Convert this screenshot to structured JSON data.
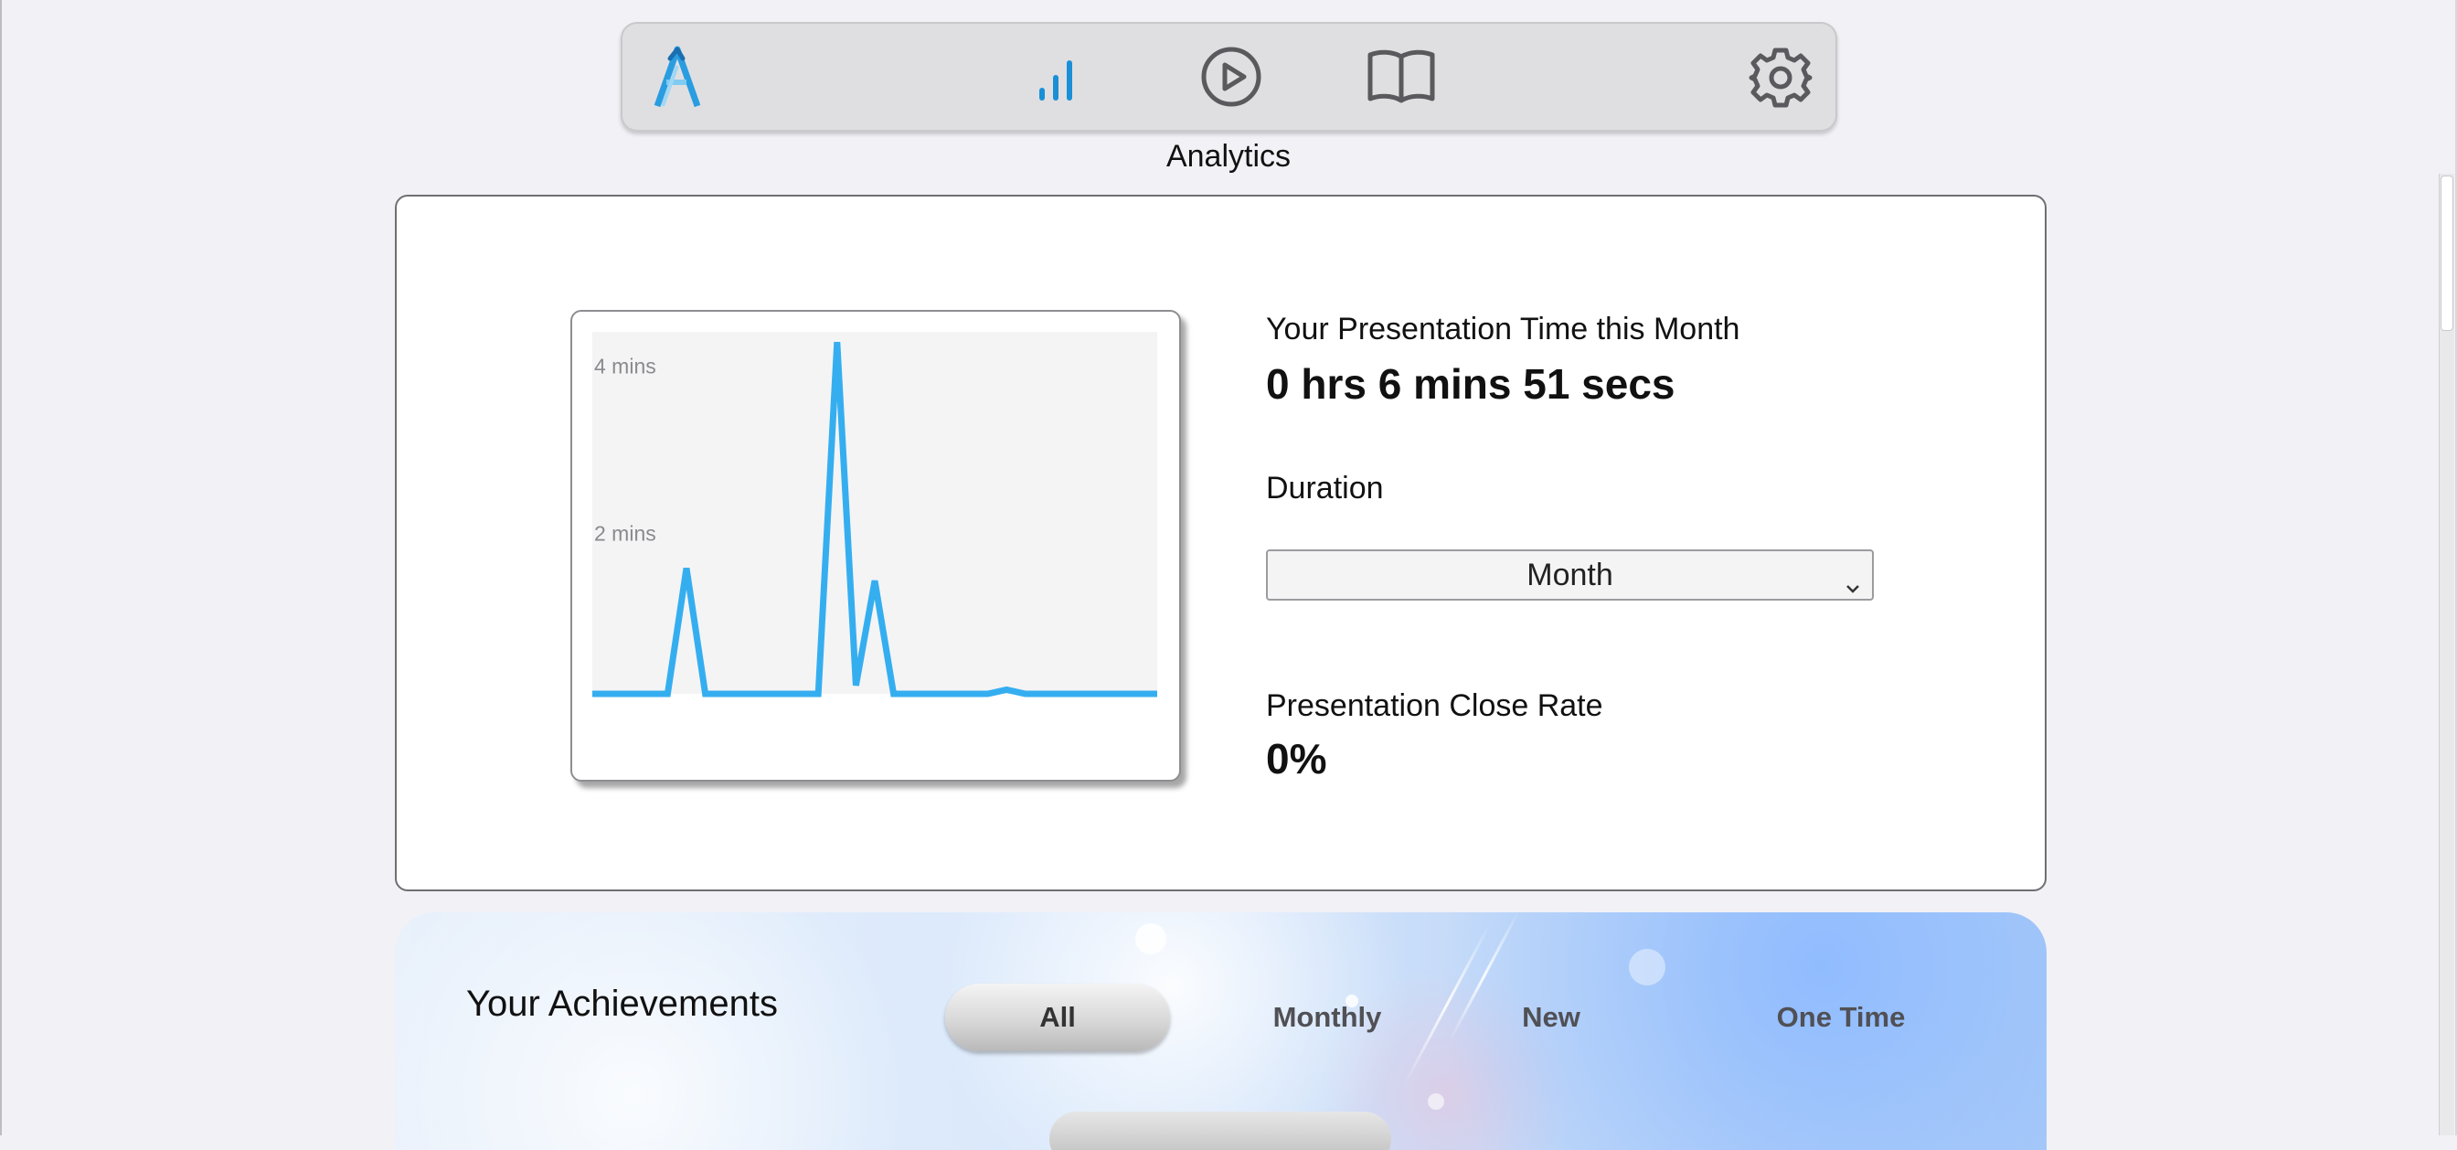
{
  "nav": {
    "logo_icon": "app-logo-icon",
    "items": [
      {
        "icon": "analytics-icon",
        "active": true
      },
      {
        "icon": "play-icon",
        "active": false
      },
      {
        "icon": "book-icon",
        "active": false
      },
      {
        "icon": "gear-icon",
        "active": false
      }
    ]
  },
  "page": {
    "title": "Analytics"
  },
  "stats": {
    "presentation_time_label": "Your Presentation Time this Month",
    "presentation_time_value": "0 hrs 6 mins 51 secs",
    "duration_label": "Duration",
    "duration_selected": "Month",
    "close_rate_label": "Presentation Close Rate",
    "close_rate_value": "0%"
  },
  "chart_data": {
    "type": "line",
    "y_tick_labels": [
      "4 mins",
      "2 mins"
    ],
    "y_ticks_minutes": [
      4,
      2
    ],
    "ylim": [
      0,
      4.3
    ],
    "grid": false,
    "x": [
      0,
      1,
      2,
      3,
      4,
      5,
      6,
      7,
      8,
      9,
      10,
      11,
      12,
      13,
      14,
      15,
      16,
      17,
      18,
      19,
      20,
      21,
      22,
      23,
      24,
      25,
      26,
      27,
      28,
      29,
      30
    ],
    "series": [
      {
        "color": "#35aef0",
        "values": [
          0,
          0,
          0,
          0,
          0,
          1.5,
          0,
          0,
          0,
          0,
          0,
          0,
          0,
          4.2,
          0.1,
          1.35,
          0,
          0,
          0,
          0,
          0,
          0,
          0.05,
          0,
          0,
          0,
          0,
          0,
          0,
          0,
          0
        ]
      }
    ]
  },
  "achievements": {
    "title": "Your Achievements",
    "tabs": [
      {
        "label": "All",
        "active": true
      },
      {
        "label": "Monthly",
        "active": false
      },
      {
        "label": "New",
        "active": false
      },
      {
        "label": "One Time",
        "active": false
      }
    ]
  },
  "colors": {
    "accent": "#1a8fd6",
    "chart_line": "#35aef0",
    "icon_gray": "#5a5a5e"
  }
}
